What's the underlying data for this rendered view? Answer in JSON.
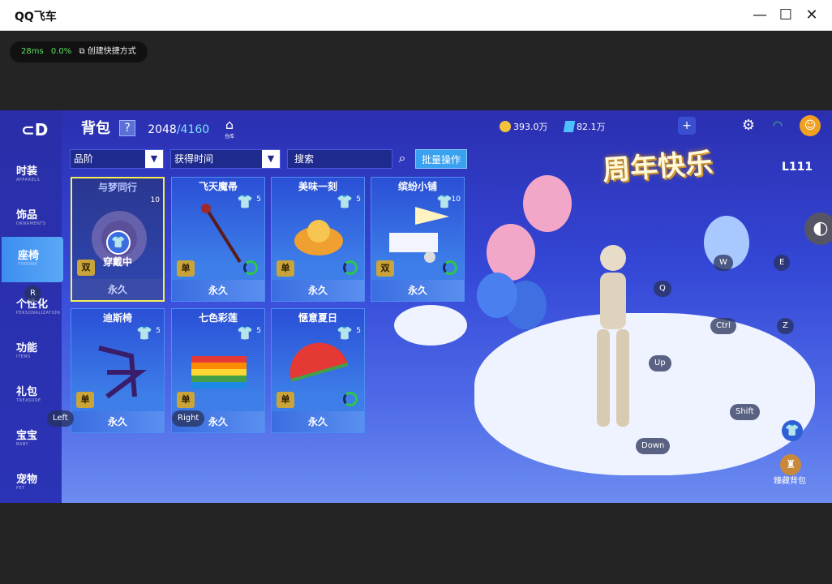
{
  "window": {
    "title": "QQ飞车",
    "minimize": "—",
    "maximize": "☐",
    "close": "✕"
  },
  "perf": {
    "ping": "28ms",
    "loss": "0.0%",
    "shortcut": "创建快捷方式"
  },
  "nav": {
    "logo": "⊂D",
    "items": [
      {
        "zh": "时装",
        "en": "APPARELS"
      },
      {
        "zh": "饰品",
        "en": "ORNAMENTS"
      },
      {
        "zh": "座椅",
        "en": "THRONE"
      },
      {
        "zh": "个性化",
        "en": "PERSONALIZATION"
      },
      {
        "zh": "功能",
        "en": "ITEMS"
      },
      {
        "zh": "礼包",
        "en": "TREASURE"
      },
      {
        "zh": "宝宝",
        "en": "BABY"
      },
      {
        "zh": "宠物",
        "en": "PET"
      }
    ]
  },
  "header": {
    "title": "背包",
    "help": "?",
    "count": "2048",
    "total": "/4160",
    "warehouse": "仓库"
  },
  "filters": {
    "grade": "品阶",
    "time": "获得时间",
    "search_placeholder": "搜索",
    "batch": "批量操作"
  },
  "items": [
    {
      "name": "与梦同行",
      "level": "10",
      "badge": "双",
      "duration": "永久",
      "wearing": "穿戴中"
    },
    {
      "name": "飞天魔帚",
      "level": "5",
      "badge": "单",
      "duration": "永久"
    },
    {
      "name": "美味一刻",
      "level": "5",
      "badge": "单",
      "duration": "永久"
    },
    {
      "name": "缤纷小铺",
      "level": "10",
      "badge": "双",
      "duration": "永久"
    },
    {
      "name": "迪斯椅",
      "level": "5",
      "badge": "单",
      "duration": "永久"
    },
    {
      "name": "七色彩莲",
      "level": "5",
      "badge": "单",
      "duration": "永久"
    },
    {
      "name": "惬意夏日",
      "level": "5",
      "badge": "单",
      "duration": "永久"
    }
  ],
  "resources": {
    "coins": "393.0万",
    "gems": "82.1万"
  },
  "banner": "周年快乐",
  "level_badge": "111",
  "collection_bag": "臻藏背包",
  "keys": {
    "r": "R",
    "left": "Left",
    "right": "Right",
    "w": "W",
    "e": "E",
    "q": "Q",
    "ctrl": "Ctrl",
    "z": "Z",
    "up": "Up",
    "down": "Down",
    "shift": "Shift"
  },
  "colors": {
    "accent": "#3aa0f0",
    "select": "#f4f05a",
    "ring": "#2dc64a"
  }
}
